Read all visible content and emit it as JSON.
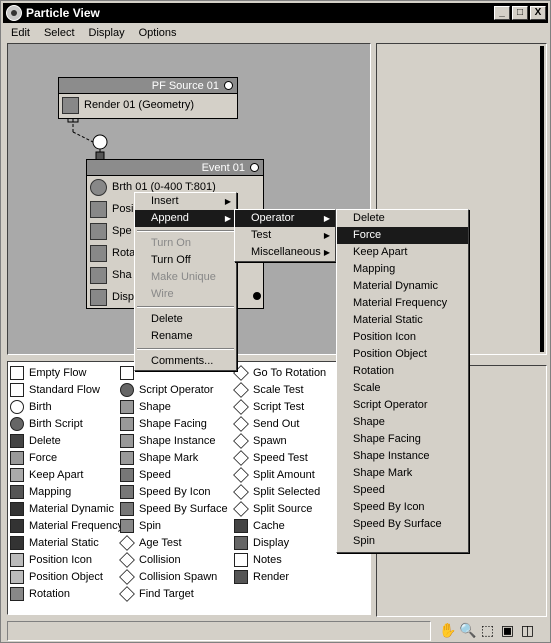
{
  "window": {
    "title": "Particle View",
    "minimize": "_",
    "maximize": "□",
    "close": "X"
  },
  "menubar": [
    "Edit",
    "Select",
    "Display",
    "Options"
  ],
  "nodes": {
    "source": {
      "title": "PF Source 01",
      "rows": [
        "Render 01 (Geometry)"
      ]
    },
    "event": {
      "title": "Event 01",
      "rows": [
        "Brth 01 (0-400 T:801)",
        "Posi",
        "Spe",
        "Rota",
        "Sha",
        "Disp"
      ]
    }
  },
  "context_menu": {
    "items": [
      "Insert",
      "Append",
      "Turn On",
      "Turn Off",
      "Make Unique",
      "Wire",
      "Delete",
      "Rename",
      "Comments..."
    ],
    "append_submenu": [
      "Operator",
      "Test",
      "Miscellaneous"
    ],
    "operator_submenu": [
      "Delete",
      "Force",
      "Keep Apart",
      "Mapping",
      "Material Dynamic",
      "Material Frequency",
      "Material Static",
      "Position Icon",
      "Position Object",
      "Rotation",
      "Scale",
      "Script Operator",
      "Shape",
      "Shape Facing",
      "Shape Instance",
      "Shape Mark",
      "Speed",
      "Speed By Icon",
      "Speed By Surface",
      "Spin"
    ]
  },
  "depot": {
    "col1": [
      "Empty Flow",
      "Standard Flow",
      "Birth",
      "Birth Script",
      "Delete",
      "Force",
      "Keep Apart",
      "Mapping",
      "Material Dynamic",
      "Material Frequency",
      "Material Static",
      "Position Icon",
      "Position Object",
      "Rotation"
    ],
    "col2": [
      "",
      "Script Operator",
      "Shape",
      "Shape Facing",
      "Shape Instance",
      "Shape Mark",
      "Speed",
      "Speed By Icon",
      "Speed By Surface",
      "Spin",
      "Age Test",
      "Collision",
      "Collision Spawn",
      "Find Target"
    ],
    "col3": [
      "Go To Rotation",
      "Scale Test",
      "Script Test",
      "Send Out",
      "Spawn",
      "Speed Test",
      "Split Amount",
      "Split Selected",
      "Split Source",
      "Cache",
      "Display",
      "Notes",
      "Render"
    ]
  },
  "toolbar_icons": [
    "hand-icon",
    "zoom-icon",
    "zoom-region-icon",
    "zoom-extents-icon",
    "no-zoom-icon"
  ]
}
